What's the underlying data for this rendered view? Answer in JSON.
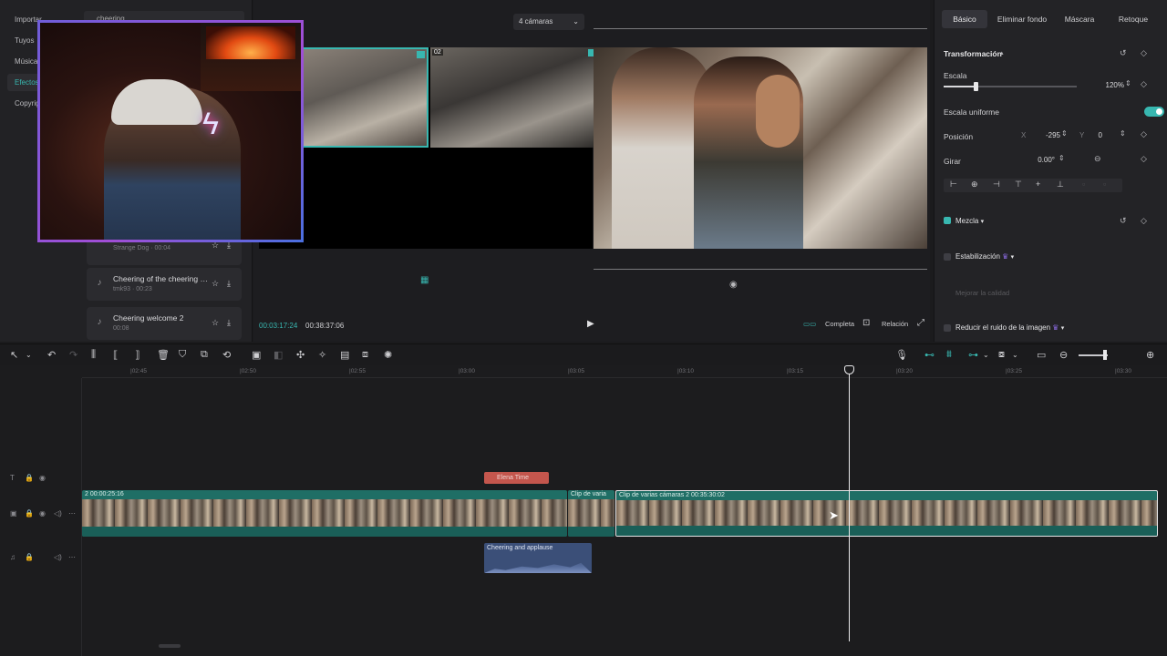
{
  "media": {
    "nav": [
      "Importar",
      "Tuyos",
      "Música",
      "Efectos",
      "Copyright"
    ],
    "active_nav": 3,
    "search_value": "cheering",
    "sounds": [
      {
        "title": "",
        "sub": "Strange Dog · 00:04"
      },
      {
        "title": "Cheering of the cheering p...",
        "sub": "tmk93 · 00:23"
      },
      {
        "title": "Cheering welcome 2",
        "sub": "00:08"
      }
    ]
  },
  "preview": {
    "camera_select": "4 cámaras",
    "cam_label_2": "02",
    "time_current": "00:03:17:24",
    "time_total": "00:38:37:06",
    "btn_complete": "Completa",
    "btn_ratio": "Relación"
  },
  "props": {
    "tabs": [
      "Básico",
      "Eliminar fondo",
      "Máscara",
      "Retoque"
    ],
    "transform_label": "Transformación",
    "scale_label": "Escala",
    "scale_value": "120%",
    "scale_fraction": 0.24,
    "uniform_label": "Escala uniforme",
    "position_label": "Posición",
    "pos_x_label": "X",
    "pos_x": "-295",
    "pos_y_label": "Y",
    "pos_y": "0",
    "rotate_label": "Girar",
    "rotate_value": "0.00°",
    "blend_label": "Mezcla",
    "stab_label": "Estabilización",
    "quality_label": "Mejorar la calidad",
    "noise_label": "Reducir el ruido de la imagen"
  },
  "timeline": {
    "ticks": [
      "|02:45",
      "|02:50",
      "|02:55",
      "|03:00",
      "|03:05",
      "|03:10",
      "|03:15",
      "|03:20",
      "|03:25",
      "|03:30"
    ],
    "title_clip": "Elena Time",
    "clip1_label": "2  00:00:25:16",
    "clip2_label": "Clip de varia",
    "clip3_label": "Clip de varias cámaras 2   00:35:30:02",
    "audio_clip": "Cheering and applause"
  },
  "colors": {
    "accent": "#38b7b0",
    "title_clip": "#c4564d",
    "audio_clip": "#3b4f78",
    "video_clip": "#1f6e65"
  }
}
